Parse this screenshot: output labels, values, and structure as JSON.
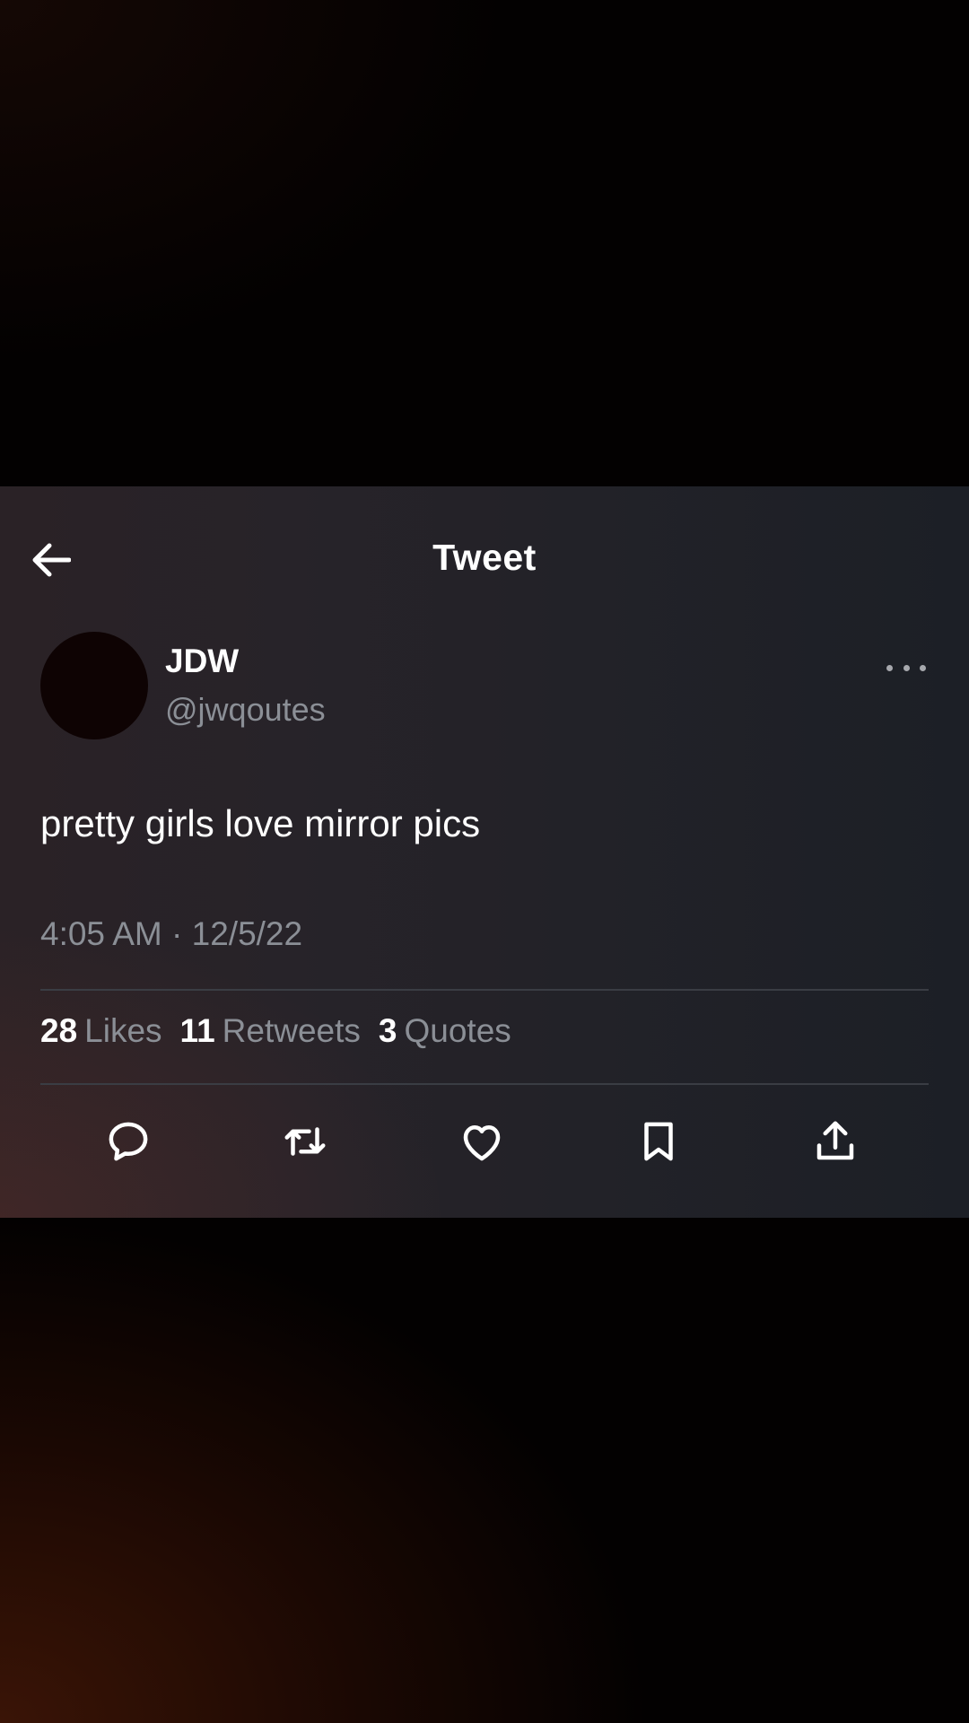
{
  "header": {
    "title": "Tweet",
    "back_icon": "arrow-left-icon"
  },
  "tweet": {
    "author": {
      "display_name": "JDW",
      "handle": "@jwqoutes"
    },
    "text": "pretty girls love mirror pics",
    "timestamp": "4:05 AM · 12/5/22",
    "stats": {
      "likes": {
        "count": "28",
        "label": "Likes"
      },
      "retweets": {
        "count": "11",
        "label": "Retweets"
      },
      "quotes": {
        "count": "3",
        "label": "Quotes"
      }
    }
  },
  "actions": [
    {
      "name": "reply",
      "icon": "reply-icon"
    },
    {
      "name": "retweet",
      "icon": "retweet-icon"
    },
    {
      "name": "like",
      "icon": "heart-icon"
    },
    {
      "name": "bookmark",
      "icon": "bookmark-icon"
    },
    {
      "name": "share",
      "icon": "share-icon"
    }
  ],
  "colors": {
    "text_primary": "#ffffff",
    "text_secondary": "#8b8f96",
    "card_background": "#25222a"
  }
}
